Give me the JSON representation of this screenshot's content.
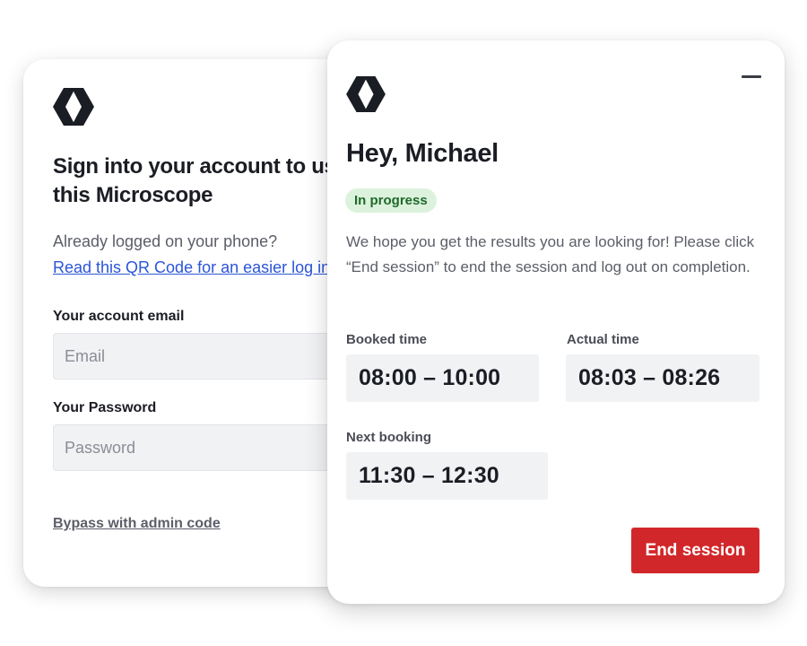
{
  "signin": {
    "logo_icon": "brand-logo-icon",
    "title": "Sign into your  account to use this Microscope",
    "already_text": "Already logged on your phone?",
    "qr_link": "Read this QR Code for an easier log in",
    "email_label": "Your account email",
    "email_placeholder": "Email",
    "email_value": "",
    "password_label": "Your Password",
    "password_placeholder": "Password",
    "password_value": "",
    "bypass_link": "Bypass with admin code"
  },
  "session": {
    "logo_icon": "brand-logo-icon",
    "minimize_icon": "minimize-icon",
    "greeting": "Hey, Michael",
    "status_badge": "In progress",
    "message": "We hope you get the results you are looking for! Please click “End session” to end the session and log out on completion.",
    "booked_label": "Booked time",
    "booked_value": "08:00 – 10:00",
    "actual_label": "Actual time",
    "actual_value": "08:03 – 08:26",
    "next_label": "Next booking",
    "next_value": "11:30 – 12:30",
    "end_button": "End session"
  },
  "colors": {
    "accent_red": "#d2272a",
    "link_blue": "#2b55d8",
    "badge_bg": "#dcf2dc",
    "badge_text": "#1f6a2c",
    "text_dark": "#1b1d24"
  }
}
